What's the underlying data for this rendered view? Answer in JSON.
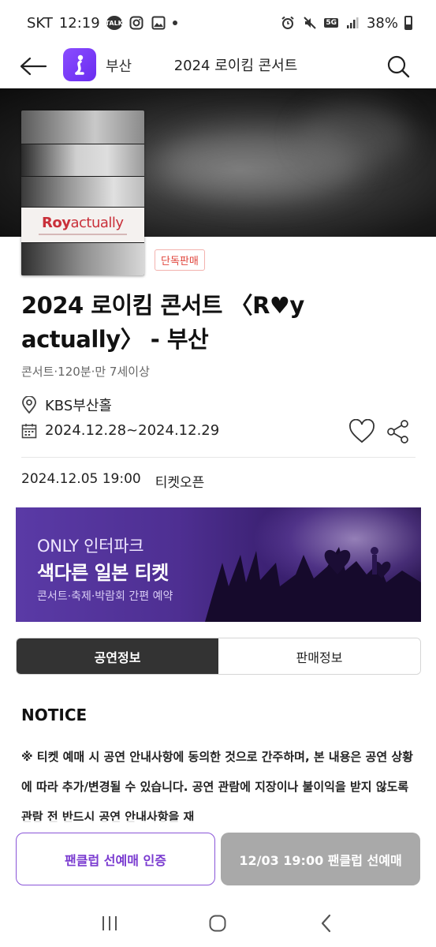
{
  "status_bar": {
    "carrier": "SKT",
    "time": "12:19",
    "notification_icons": [
      "talk-icon",
      "instagram-icon",
      "gallery-icon",
      "more-dot"
    ],
    "talk_label": "TALK",
    "network": "5G",
    "battery": "38%"
  },
  "header": {
    "region": "부산",
    "title": "2024 로이킴 콘서트",
    "icons": [
      "back-arrow-icon",
      "app-logo-icon",
      "search-icon"
    ]
  },
  "poster": {
    "logo_main": "Roy",
    "logo_rest": "actually"
  },
  "badge": "단독판매",
  "show": {
    "title": "2024 로이킴 콘서트 〈R♥y actually〉 - 부산",
    "meta": "콘서트·120분·만 7세이상",
    "venue": "KBS부산홀",
    "period": "2024.12.28~2024.12.29"
  },
  "ticket_open": {
    "datetime": "2024.12.05 19:00",
    "label": "티켓오픈"
  },
  "banner": {
    "line1": "ONLY 인터파크",
    "line2": "색다른 일본 티켓",
    "caption": "콘서트·축제·박람회 간편 예약"
  },
  "tabs": [
    {
      "label": "공연정보",
      "active": true
    },
    {
      "label": "판매정보",
      "active": false
    }
  ],
  "notice": {
    "heading": "NOTICE",
    "body": "※ 티켓 예매 시 공연 안내사항에 동의한 것으로 간주하며, 본 내용은 공연 상황에 따라 추가/변경될 수 있습니다. 공연 관람에 지장이나 불이익을 받지 않도록 관람 전 반드시 공연 안내사항을 재"
  },
  "actions": {
    "certify_label": "팬클럽 선예매 인증",
    "presale_label": "12/03 19:00 팬클럽 선예매"
  },
  "colors": {
    "accent": "#7a3bd0",
    "badge_red": "#e0433a",
    "tab_active": "#333333",
    "presale_disabled": "#a9a9a9"
  }
}
